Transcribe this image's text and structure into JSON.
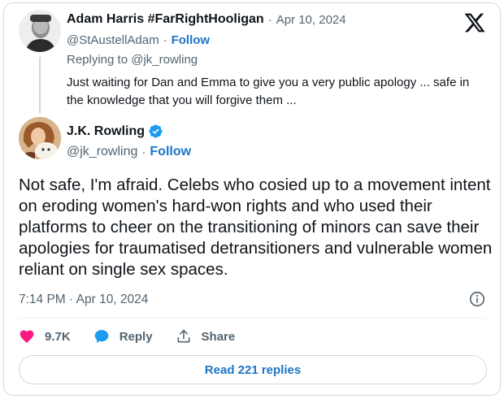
{
  "parent_tweet": {
    "display_name": "Adam Harris #FarRightHooligan",
    "date": "Apr 10, 2024",
    "handle": "@StAustellAdam",
    "follow_label": "Follow",
    "replying_to": "Replying to @jk_rowling",
    "text": "Just waiting for Dan and Emma to give you a very public apology ... safe in the knowledge that you will forgive them ..."
  },
  "main_tweet": {
    "display_name": "J.K. Rowling",
    "handle": "@jk_rowling",
    "follow_label": "Follow",
    "text": "Not safe, I'm afraid. Celebs who cosied up to a movement intent on eroding women's hard-won rights and who used their platforms to cheer on the transitioning of minors can save their apologies for traumatised detransitioners and vulnerable women reliant on single sex spaces.",
    "timestamp": "7:14 PM · Apr 10, 2024"
  },
  "actions": {
    "like_count": "9.7K",
    "reply_label": "Reply",
    "share_label": "Share"
  },
  "read_replies_label": "Read 221 replies",
  "separator": "·",
  "icons": {
    "logo": "x-logo-icon",
    "verified": "verified-badge-icon",
    "info": "info-icon",
    "like": "heart-icon",
    "reply": "speech-bubble-icon",
    "share": "share-upload-icon"
  },
  "colors": {
    "link_blue": "#1d75c7",
    "verified_blue": "#1d9bf0",
    "like_pink": "#f91880",
    "secondary_text": "#536471",
    "border": "#cfd9de"
  }
}
